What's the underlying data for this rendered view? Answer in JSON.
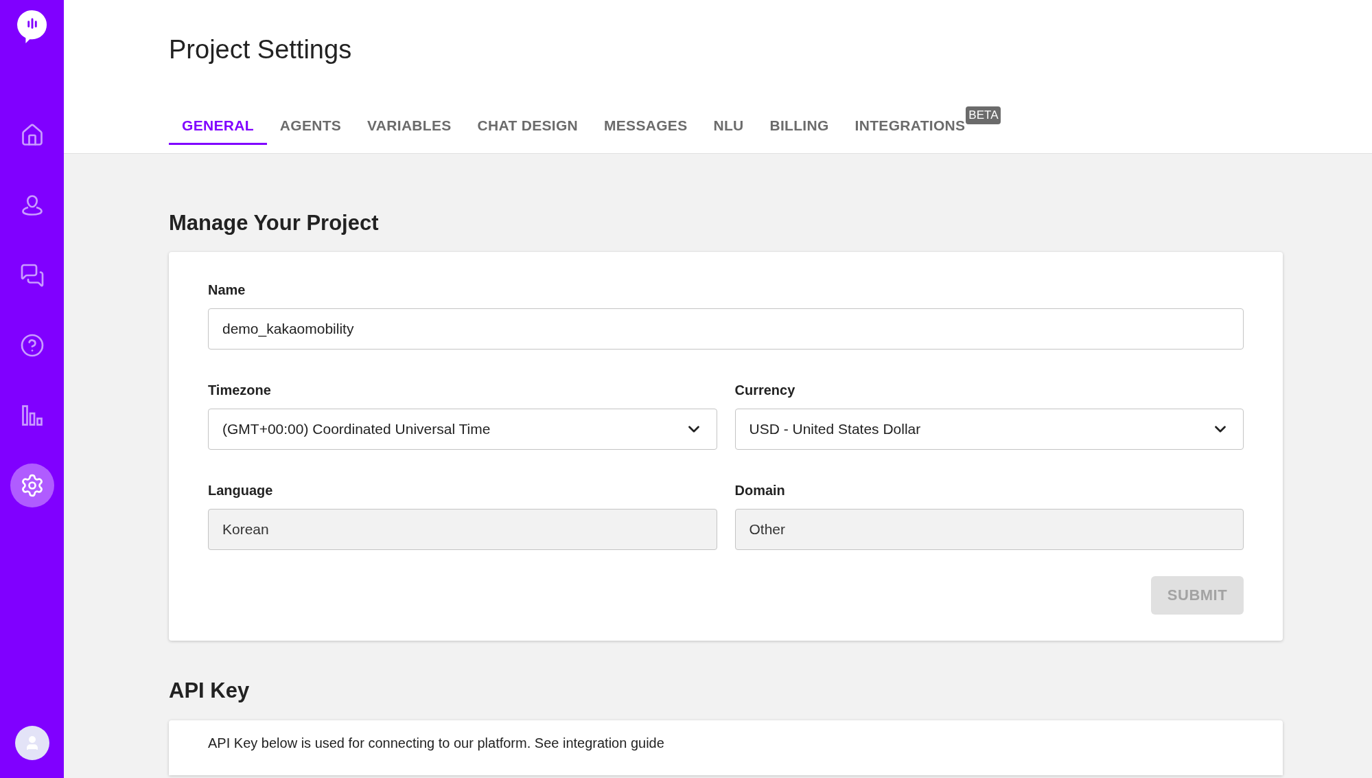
{
  "sidebar": {
    "items": [
      {
        "selected": false
      },
      {
        "selected": false
      },
      {
        "selected": false
      },
      {
        "selected": false
      },
      {
        "selected": false
      },
      {
        "selected": true
      }
    ]
  },
  "page_title": "Project Settings",
  "tabs": [
    {
      "label": "GENERAL",
      "selected": true
    },
    {
      "label": "AGENTS",
      "selected": false
    },
    {
      "label": "VARIABLES",
      "selected": false
    },
    {
      "label": "CHAT DESIGN",
      "selected": false
    },
    {
      "label": "MESSAGES",
      "selected": false
    },
    {
      "label": "NLU",
      "selected": false
    },
    {
      "label": "BILLING",
      "selected": false
    },
    {
      "label": "INTEGRATIONS",
      "selected": false,
      "badge": "BETA"
    }
  ],
  "manage_section": {
    "title": "Manage Your Project",
    "name_field": {
      "label": "Name",
      "value": "demo_kakaomobility"
    },
    "fields": [
      {
        "kind": "select",
        "label": "Timezone",
        "value": "(GMT+00:00) Coordinated Universal Time",
        "disabled": false
      },
      {
        "kind": "select",
        "label": "Currency",
        "value": "USD - United States Dollar",
        "disabled": false
      },
      {
        "kind": "text",
        "label": "Language",
        "value": "Korean",
        "disabled": true
      },
      {
        "kind": "text",
        "label": "Domain",
        "value": "Other",
        "disabled": true
      }
    ],
    "submit": {
      "label": "SUBMIT",
      "disabled": true
    }
  },
  "api_section": {
    "title": "API Key",
    "description": "API Key below is used for connecting to our platform. See integration guide"
  }
}
